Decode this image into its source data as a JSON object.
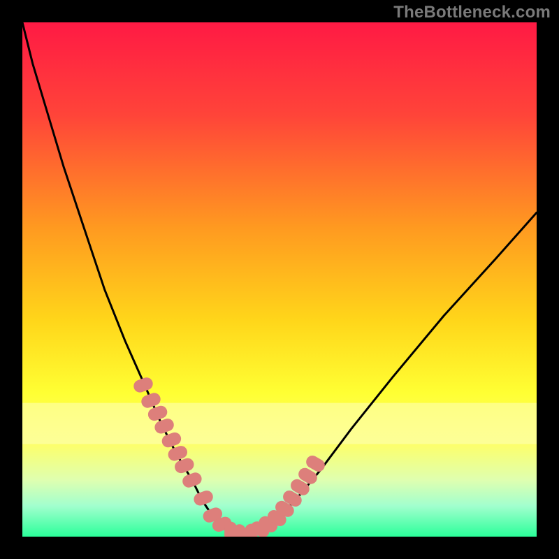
{
  "attribution": "TheBottleneck.com",
  "colors": {
    "frame": "#000000",
    "gradient_stops": [
      {
        "offset": 0.0,
        "color": "#ff1a44"
      },
      {
        "offset": 0.18,
        "color": "#ff4439"
      },
      {
        "offset": 0.4,
        "color": "#ff9a20"
      },
      {
        "offset": 0.58,
        "color": "#ffd61a"
      },
      {
        "offset": 0.72,
        "color": "#ffff33"
      },
      {
        "offset": 0.82,
        "color": "#fdff6a"
      },
      {
        "offset": 0.89,
        "color": "#dfffb0"
      },
      {
        "offset": 0.94,
        "color": "#a2ffce"
      },
      {
        "offset": 1.0,
        "color": "#2bff9a"
      }
    ],
    "pale_band": "#fdffbd",
    "curve": "#000000",
    "marker": "#dd7f7b"
  },
  "chart_data": {
    "type": "line",
    "title": "",
    "xlabel": "",
    "ylabel": "",
    "xlim": [
      0,
      100
    ],
    "ylim": [
      0,
      100
    ],
    "series": [
      {
        "name": "bottleneck-curve",
        "x": [
          0,
          2,
          5,
          8,
          12,
          16,
          20,
          24,
          27,
          30,
          33,
          35,
          37,
          38.5,
          40,
          42,
          44,
          46,
          49,
          53,
          58,
          64,
          72,
          82,
          92,
          100
        ],
        "y": [
          100,
          92,
          82,
          72,
          60,
          48,
          38,
          29,
          22,
          16,
          11,
          7,
          4,
          2.5,
          1.3,
          0.4,
          0.5,
          1.3,
          3,
          7,
          13,
          21,
          31,
          43,
          54,
          63
        ]
      }
    ],
    "markers": {
      "name": "highlight-segment",
      "x": [
        23.5,
        25,
        26.3,
        27.6,
        29,
        30.2,
        31.5,
        33,
        35.2,
        37,
        38.8,
        40.5,
        42.2,
        44.5,
        46.2,
        47.8,
        49.5,
        51,
        52.5,
        54,
        55.5,
        57
      ],
      "y": [
        29.5,
        26.5,
        24,
        21.5,
        18.8,
        16.2,
        13.8,
        11,
        7.5,
        4.2,
        2.4,
        1.0,
        0.5,
        0.6,
        1.4,
        2.4,
        3.6,
        5.4,
        7.4,
        9.6,
        11.8,
        14.2
      ]
    },
    "pale_band_y_range": [
      74,
      82
    ]
  }
}
